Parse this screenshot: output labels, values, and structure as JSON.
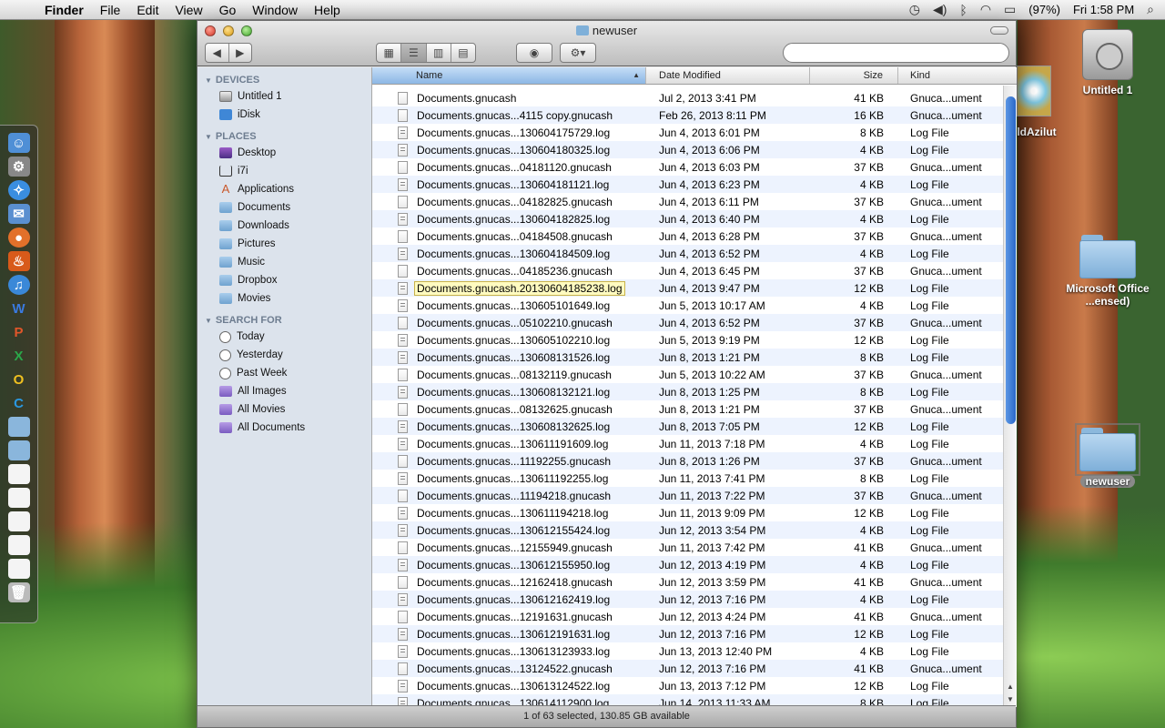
{
  "menubar": {
    "app": "Finder",
    "items": [
      "File",
      "Edit",
      "View",
      "Go",
      "Window",
      "Help"
    ],
    "battery": "(97%)",
    "clock": "Fri 1:58 PM"
  },
  "desktop": {
    "icons": [
      "Untitled 1",
      "Microsoft Office ...ensed)",
      "newuser",
      "ldAzilut"
    ]
  },
  "window": {
    "title": "newuser",
    "search_placeholder": "",
    "status": "1 of 63 selected, 130.85 GB available"
  },
  "sidebar": {
    "devices_header": "DEVICES",
    "devices": [
      "Untitled 1",
      "iDisk"
    ],
    "places_header": "PLACES",
    "places": [
      "Desktop",
      "i7i",
      "Applications",
      "Documents",
      "Downloads",
      "Pictures",
      "Music",
      "Dropbox",
      "Movies"
    ],
    "search_header": "SEARCH FOR",
    "search": [
      "Today",
      "Yesterday",
      "Past Week",
      "All Images",
      "All Movies",
      "All Documents"
    ]
  },
  "columns": {
    "name": "Name",
    "date": "Date Modified",
    "size": "Size",
    "kind": "Kind"
  },
  "files": [
    {
      "name": "Documents.gnucash",
      "date": "Jul 2, 2013 3:41 PM",
      "size": "41 KB",
      "kind": "Gnuca...ument"
    },
    {
      "name": "Documents.gnucas...4115 copy.gnucash",
      "date": "Feb 26, 2013 8:11 PM",
      "size": "16 KB",
      "kind": "Gnuca...ument"
    },
    {
      "name": "Documents.gnucas...130604175729.log",
      "date": "Jun 4, 2013 6:01 PM",
      "size": "8 KB",
      "kind": "Log File"
    },
    {
      "name": "Documents.gnucas...130604180325.log",
      "date": "Jun 4, 2013 6:06 PM",
      "size": "4 KB",
      "kind": "Log File"
    },
    {
      "name": "Documents.gnucas...04181120.gnucash",
      "date": "Jun 4, 2013 6:03 PM",
      "size": "37 KB",
      "kind": "Gnuca...ument"
    },
    {
      "name": "Documents.gnucas...130604181121.log",
      "date": "Jun 4, 2013 6:23 PM",
      "size": "4 KB",
      "kind": "Log File"
    },
    {
      "name": "Documents.gnucas...04182825.gnucash",
      "date": "Jun 4, 2013 6:11 PM",
      "size": "37 KB",
      "kind": "Gnuca...ument"
    },
    {
      "name": "Documents.gnucas...130604182825.log",
      "date": "Jun 4, 2013 6:40 PM",
      "size": "4 KB",
      "kind": "Log File"
    },
    {
      "name": "Documents.gnucas...04184508.gnucash",
      "date": "Jun 4, 2013 6:28 PM",
      "size": "37 KB",
      "kind": "Gnuca...ument"
    },
    {
      "name": "Documents.gnucas...130604184509.log",
      "date": "Jun 4, 2013 6:52 PM",
      "size": "4 KB",
      "kind": "Log File"
    },
    {
      "name": "Documents.gnucas...04185236.gnucash",
      "date": "Jun 4, 2013 6:45 PM",
      "size": "37 KB",
      "kind": "Gnuca...ument"
    },
    {
      "name": "Documents.gnucash.20130604185238.log",
      "date": "Jun 4, 2013 9:47 PM",
      "size": "12 KB",
      "kind": "Log File",
      "selected": true
    },
    {
      "name": "Documents.gnucas...130605101649.log",
      "date": "Jun 5, 2013 10:17 AM",
      "size": "4 KB",
      "kind": "Log File"
    },
    {
      "name": "Documents.gnucas...05102210.gnucash",
      "date": "Jun 4, 2013 6:52 PM",
      "size": "37 KB",
      "kind": "Gnuca...ument"
    },
    {
      "name": "Documents.gnucas...130605102210.log",
      "date": "Jun 5, 2013 9:19 PM",
      "size": "12 KB",
      "kind": "Log File"
    },
    {
      "name": "Documents.gnucas...130608131526.log",
      "date": "Jun 8, 2013 1:21 PM",
      "size": "8 KB",
      "kind": "Log File"
    },
    {
      "name": "Documents.gnucas...08132119.gnucash",
      "date": "Jun 5, 2013 10:22 AM",
      "size": "37 KB",
      "kind": "Gnuca...ument"
    },
    {
      "name": "Documents.gnucas...130608132121.log",
      "date": "Jun 8, 2013 1:25 PM",
      "size": "8 KB",
      "kind": "Log File"
    },
    {
      "name": "Documents.gnucas...08132625.gnucash",
      "date": "Jun 8, 2013 1:21 PM",
      "size": "37 KB",
      "kind": "Gnuca...ument"
    },
    {
      "name": "Documents.gnucas...130608132625.log",
      "date": "Jun 8, 2013 7:05 PM",
      "size": "12 KB",
      "kind": "Log File"
    },
    {
      "name": "Documents.gnucas...130611191609.log",
      "date": "Jun 11, 2013 7:18 PM",
      "size": "4 KB",
      "kind": "Log File"
    },
    {
      "name": "Documents.gnucas...11192255.gnucash",
      "date": "Jun 8, 2013 1:26 PM",
      "size": "37 KB",
      "kind": "Gnuca...ument"
    },
    {
      "name": "Documents.gnucas...130611192255.log",
      "date": "Jun 11, 2013 7:41 PM",
      "size": "8 KB",
      "kind": "Log File"
    },
    {
      "name": "Documents.gnucas...11194218.gnucash",
      "date": "Jun 11, 2013 7:22 PM",
      "size": "37 KB",
      "kind": "Gnuca...ument"
    },
    {
      "name": "Documents.gnucas...130611194218.log",
      "date": "Jun 11, 2013 9:09 PM",
      "size": "12 KB",
      "kind": "Log File"
    },
    {
      "name": "Documents.gnucas...130612155424.log",
      "date": "Jun 12, 2013 3:54 PM",
      "size": "4 KB",
      "kind": "Log File"
    },
    {
      "name": "Documents.gnucas...12155949.gnucash",
      "date": "Jun 11, 2013 7:42 PM",
      "size": "41 KB",
      "kind": "Gnuca...ument"
    },
    {
      "name": "Documents.gnucas...130612155950.log",
      "date": "Jun 12, 2013 4:19 PM",
      "size": "4 KB",
      "kind": "Log File"
    },
    {
      "name": "Documents.gnucas...12162418.gnucash",
      "date": "Jun 12, 2013 3:59 PM",
      "size": "41 KB",
      "kind": "Gnuca...ument"
    },
    {
      "name": "Documents.gnucas...130612162419.log",
      "date": "Jun 12, 2013 7:16 PM",
      "size": "4 KB",
      "kind": "Log File"
    },
    {
      "name": "Documents.gnucas...12191631.gnucash",
      "date": "Jun 12, 2013 4:24 PM",
      "size": "41 KB",
      "kind": "Gnuca...ument"
    },
    {
      "name": "Documents.gnucas...130612191631.log",
      "date": "Jun 12, 2013 7:16 PM",
      "size": "12 KB",
      "kind": "Log File"
    },
    {
      "name": "Documents.gnucas...130613123933.log",
      "date": "Jun 13, 2013 12:40 PM",
      "size": "4 KB",
      "kind": "Log File"
    },
    {
      "name": "Documents.gnucas...13124522.gnucash",
      "date": "Jun 12, 2013 7:16 PM",
      "size": "41 KB",
      "kind": "Gnuca...ument"
    },
    {
      "name": "Documents.gnucas...130613124522.log",
      "date": "Jun 13, 2013 7:12 PM",
      "size": "12 KB",
      "kind": "Log File"
    },
    {
      "name": "Documents.gnucas...130614112900.log",
      "date": "Jun 14, 2013 11:33 AM",
      "size": "8 KB",
      "kind": "Log File"
    }
  ],
  "colors": {
    "selection_highlight": "#fffbc0",
    "sort_column": "#8cb7e5",
    "scroll_thumb": "#2a68c9"
  }
}
